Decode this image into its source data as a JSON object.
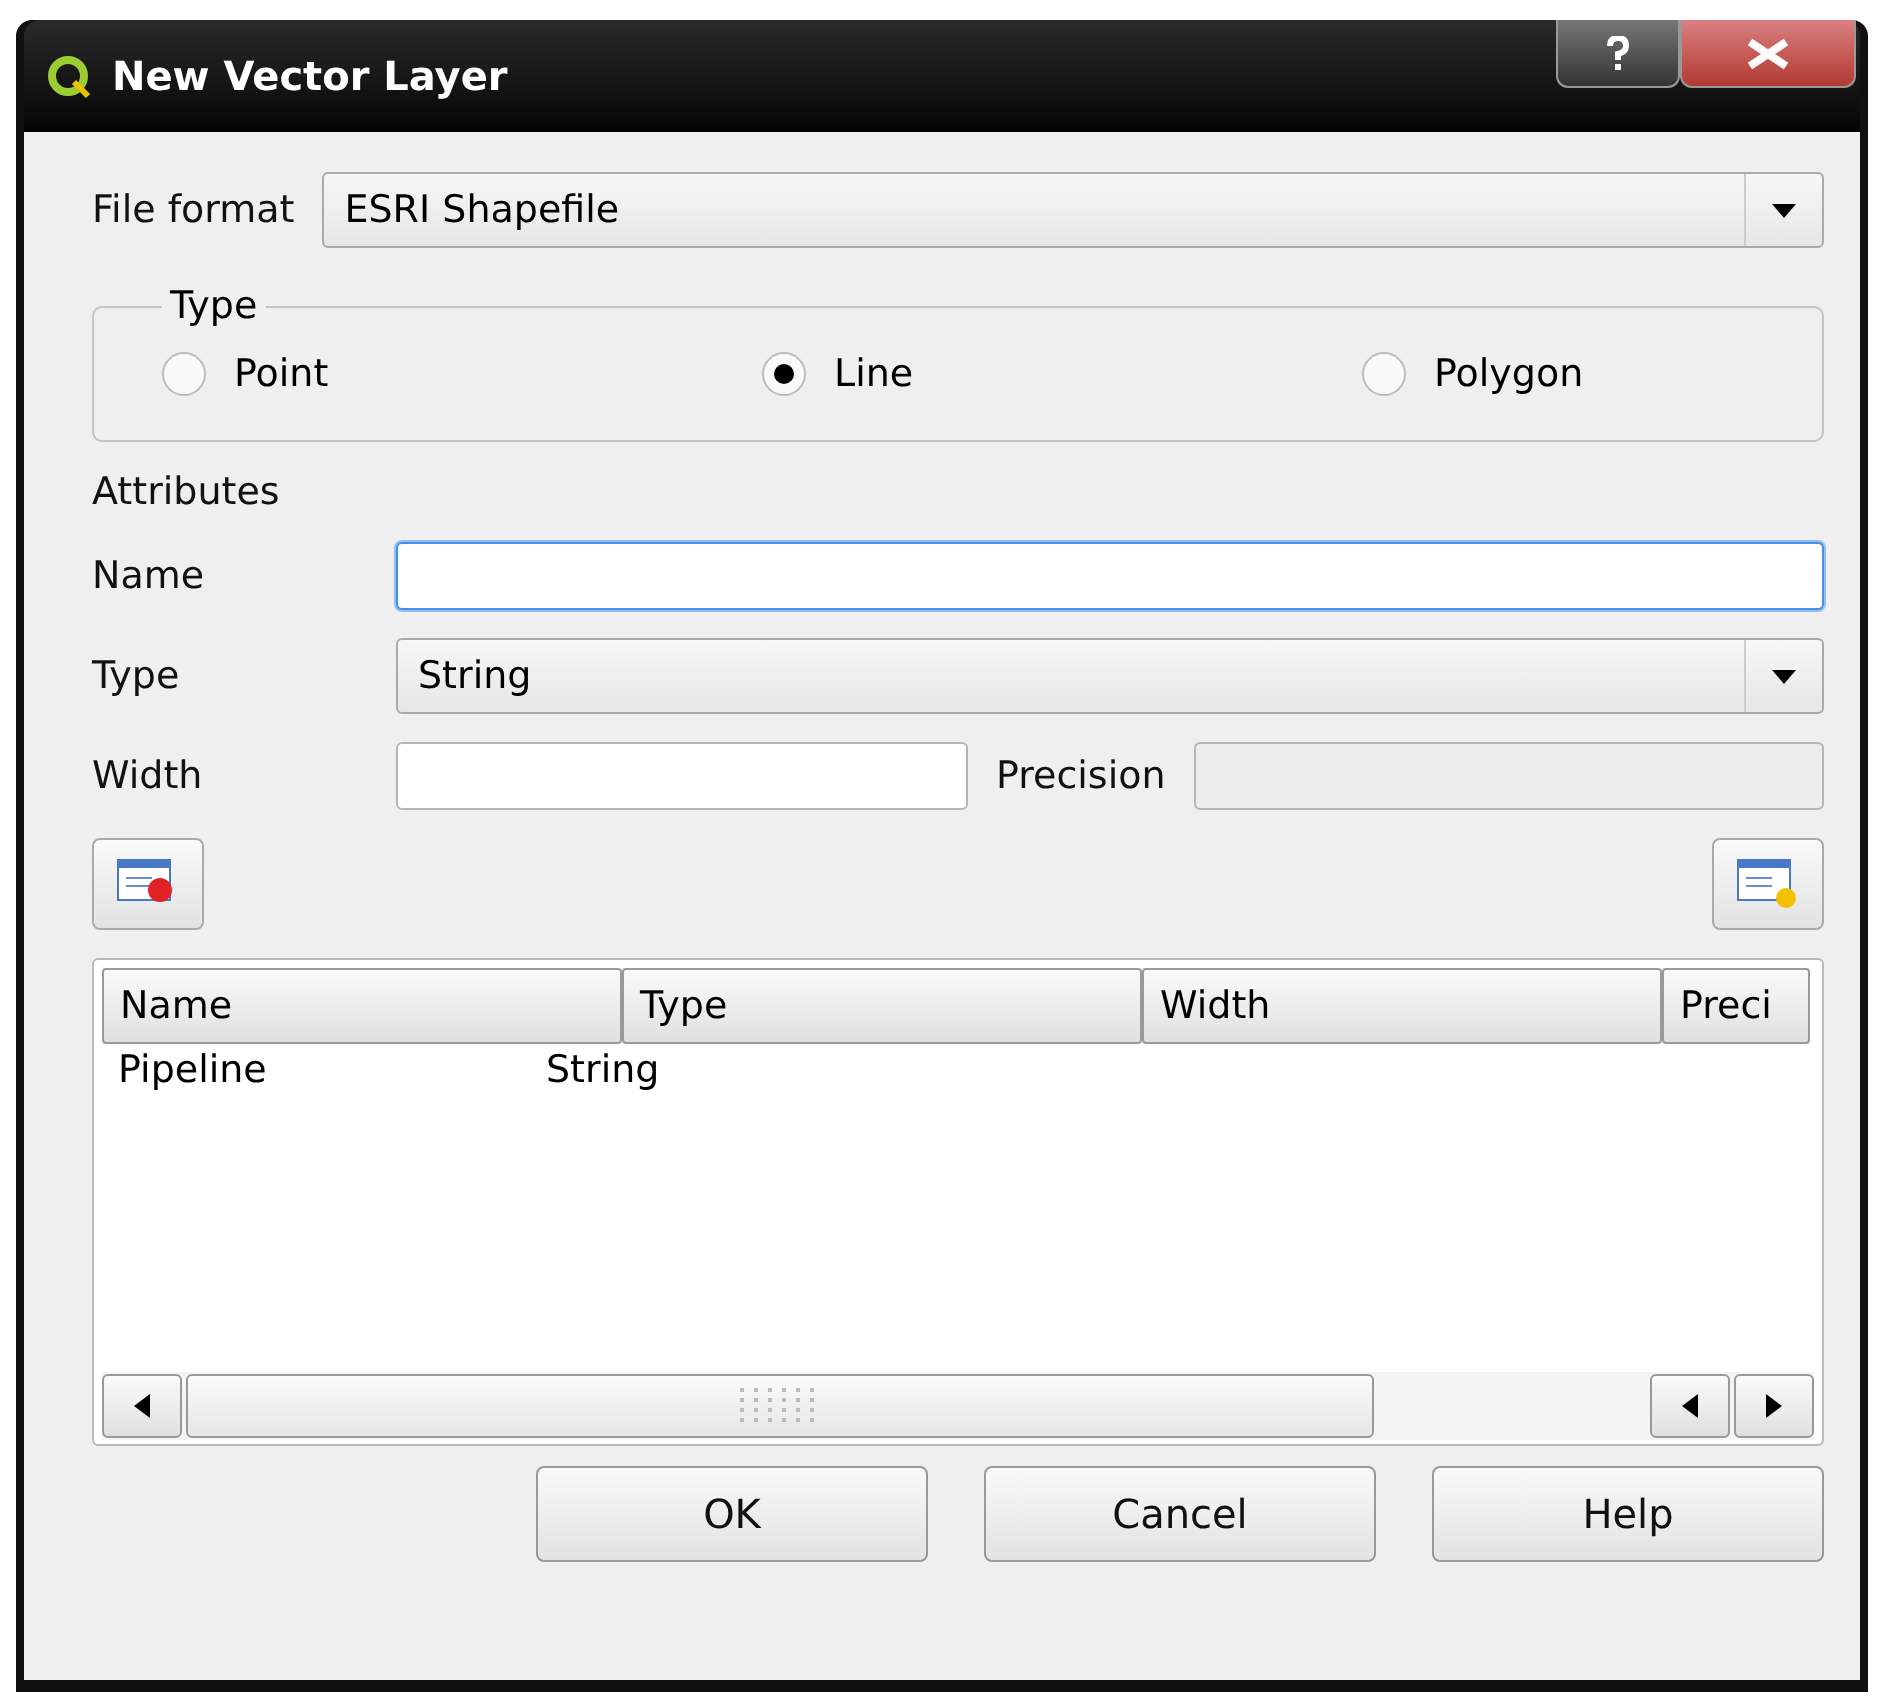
{
  "window": {
    "title": "New Vector Layer"
  },
  "file_format": {
    "label": "File format",
    "value": "ESRI Shapefile"
  },
  "type_group": {
    "title": "Type",
    "options": [
      {
        "label": "Point",
        "selected": false
      },
      {
        "label": "Line",
        "selected": true
      },
      {
        "label": "Polygon",
        "selected": false
      }
    ]
  },
  "attributes": {
    "title": "Attributes",
    "name": {
      "label": "Name",
      "focused": true
    },
    "type": {
      "label": "Type",
      "value": "String"
    },
    "width": {
      "label": "Width"
    },
    "precision": {
      "label": "Precision",
      "disabled": true
    }
  },
  "table": {
    "columns": [
      "Name",
      "Type",
      "Width",
      "Preci"
    ],
    "rows": [
      [
        "Pipeline",
        "String",
        "",
        ""
      ]
    ]
  },
  "buttons": [
    "OK",
    "Cancel",
    "Help"
  ]
}
